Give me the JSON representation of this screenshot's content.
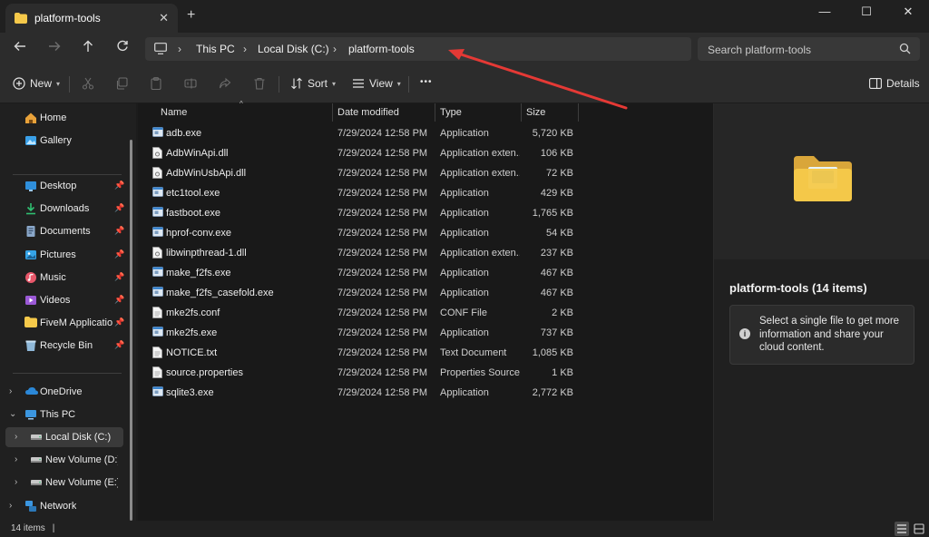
{
  "window": {
    "tab_title": "platform-tools",
    "tab_close": "✕",
    "new_tab": "+",
    "minimize": "—",
    "maximize": "☐",
    "close": "✕"
  },
  "address": {
    "breadcrumb": [
      "This PC",
      "Local Disk (C:)",
      "platform-tools"
    ],
    "search_placeholder": "Search platform-tools"
  },
  "toolbar": {
    "new_label": "New",
    "sort_label": "Sort",
    "view_label": "View",
    "more_label": "•••",
    "details_label": "Details"
  },
  "nav": {
    "quick": [
      {
        "label": "Home",
        "icon": "home-icon"
      },
      {
        "label": "Gallery",
        "icon": "gallery-icon"
      }
    ],
    "pinned": [
      {
        "label": "Desktop",
        "icon": "desktop-icon"
      },
      {
        "label": "Downloads",
        "icon": "downloads-icon"
      },
      {
        "label": "Documents",
        "icon": "documents-icon"
      },
      {
        "label": "Pictures",
        "icon": "pictures-icon"
      },
      {
        "label": "Music",
        "icon": "music-icon"
      },
      {
        "label": "Videos",
        "icon": "videos-icon"
      },
      {
        "label": "FiveM Application I",
        "icon": "folder-icon"
      },
      {
        "label": "Recycle Bin",
        "icon": "recycle-bin-icon"
      }
    ],
    "tree": [
      {
        "label": "OneDrive",
        "icon": "onedrive-icon"
      },
      {
        "label": "This PC",
        "icon": "this-pc-icon"
      },
      {
        "label": "Local Disk (C:)",
        "icon": "drive-icon"
      },
      {
        "label": "New Volume (D:)",
        "icon": "drive-icon"
      },
      {
        "label": "New Volume (E:)",
        "icon": "drive-icon"
      },
      {
        "label": "Network",
        "icon": "network-icon"
      }
    ]
  },
  "columns": {
    "name": "Name",
    "date": "Date modified",
    "type": "Type",
    "size": "Size"
  },
  "files": [
    {
      "name": "adb.exe",
      "date": "7/29/2024 12:58 PM",
      "type": "Application",
      "size": "5,720 KB",
      "kind": "exe"
    },
    {
      "name": "AdbWinApi.dll",
      "date": "7/29/2024 12:58 PM",
      "type": "Application exten...",
      "size": "106 KB",
      "kind": "dll"
    },
    {
      "name": "AdbWinUsbApi.dll",
      "date": "7/29/2024 12:58 PM",
      "type": "Application exten...",
      "size": "72 KB",
      "kind": "dll"
    },
    {
      "name": "etc1tool.exe",
      "date": "7/29/2024 12:58 PM",
      "type": "Application",
      "size": "429 KB",
      "kind": "exe"
    },
    {
      "name": "fastboot.exe",
      "date": "7/29/2024 12:58 PM",
      "type": "Application",
      "size": "1,765 KB",
      "kind": "exe"
    },
    {
      "name": "hprof-conv.exe",
      "date": "7/29/2024 12:58 PM",
      "type": "Application",
      "size": "54 KB",
      "kind": "exe"
    },
    {
      "name": "libwinpthread-1.dll",
      "date": "7/29/2024 12:58 PM",
      "type": "Application exten...",
      "size": "237 KB",
      "kind": "dll"
    },
    {
      "name": "make_f2fs.exe",
      "date": "7/29/2024 12:58 PM",
      "type": "Application",
      "size": "467 KB",
      "kind": "exe"
    },
    {
      "name": "make_f2fs_casefold.exe",
      "date": "7/29/2024 12:58 PM",
      "type": "Application",
      "size": "467 KB",
      "kind": "exe"
    },
    {
      "name": "mke2fs.conf",
      "date": "7/29/2024 12:58 PM",
      "type": "CONF File",
      "size": "2 KB",
      "kind": "doc"
    },
    {
      "name": "mke2fs.exe",
      "date": "7/29/2024 12:58 PM",
      "type": "Application",
      "size": "737 KB",
      "kind": "exe"
    },
    {
      "name": "NOTICE.txt",
      "date": "7/29/2024 12:58 PM",
      "type": "Text Document",
      "size": "1,085 KB",
      "kind": "doc"
    },
    {
      "name": "source.properties",
      "date": "7/29/2024 12:58 PM",
      "type": "Properties Source ...",
      "size": "1 KB",
      "kind": "doc"
    },
    {
      "name": "sqlite3.exe",
      "date": "7/29/2024 12:58 PM",
      "type": "Application",
      "size": "2,772 KB",
      "kind": "exe"
    }
  ],
  "details": {
    "title": "platform-tools (14 items)",
    "info": "Select a single file to get more information and share your cloud content."
  },
  "status": {
    "item_count": "14 items",
    "cursor": "|"
  },
  "colors": {
    "accent": "#60cdff",
    "folder": "#f6c94a",
    "annotation_arrow": "#e53935"
  }
}
